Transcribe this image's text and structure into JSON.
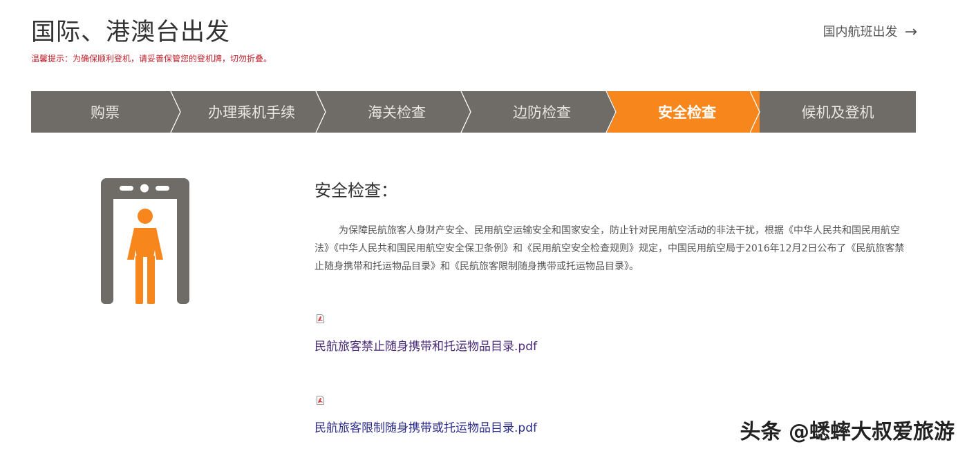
{
  "header": {
    "title": "国际、港澳台出发",
    "tip": "温馨提示：为确保顺利登机，请妥善保管您的登机牌，切勿折叠。",
    "domestic_link": "国内航班出发",
    "domestic_arrow": "→"
  },
  "steps": [
    {
      "label": "购票",
      "active": false
    },
    {
      "label": "办理乘机手续",
      "active": false
    },
    {
      "label": "海关检查",
      "active": false
    },
    {
      "label": "边防检查",
      "active": false
    },
    {
      "label": "安全检查",
      "active": true
    },
    {
      "label": "候机及登机",
      "active": false
    }
  ],
  "content": {
    "title": "安全检查：",
    "description": "为保障民航旅客人身财产安全、民用航空运输安全和国家安全，防止针对民用航空活动的非法干扰，根据《中华人民共和国民用航空法》《中华人民共和国民用航空安全保卫条例》和《民用航空安全检查规则》规定，中国民用航空局于2016年12月2日公布了《民航旅客禁止随身携带和托运物品目录》和《民航旅客限制随身携带或托运物品目录》。",
    "files": [
      {
        "name": "民航旅客禁止随身携带和托运物品目录.pdf",
        "icon": "pdf-icon"
      },
      {
        "name": "民航旅客限制随身携带或托运物品目录.pdf",
        "icon": "pdf-icon"
      }
    ]
  },
  "illustration": {
    "icon": "security-gate-icon",
    "gate_color": "#6f6b66",
    "person_color": "#f7861c"
  },
  "colors": {
    "accent": "#f7861c",
    "bar": "#6f6b66",
    "tip": "#c0202a",
    "link": "#4a2a7a"
  },
  "watermark": "头条 @蟋蟀大叔爱旅游"
}
